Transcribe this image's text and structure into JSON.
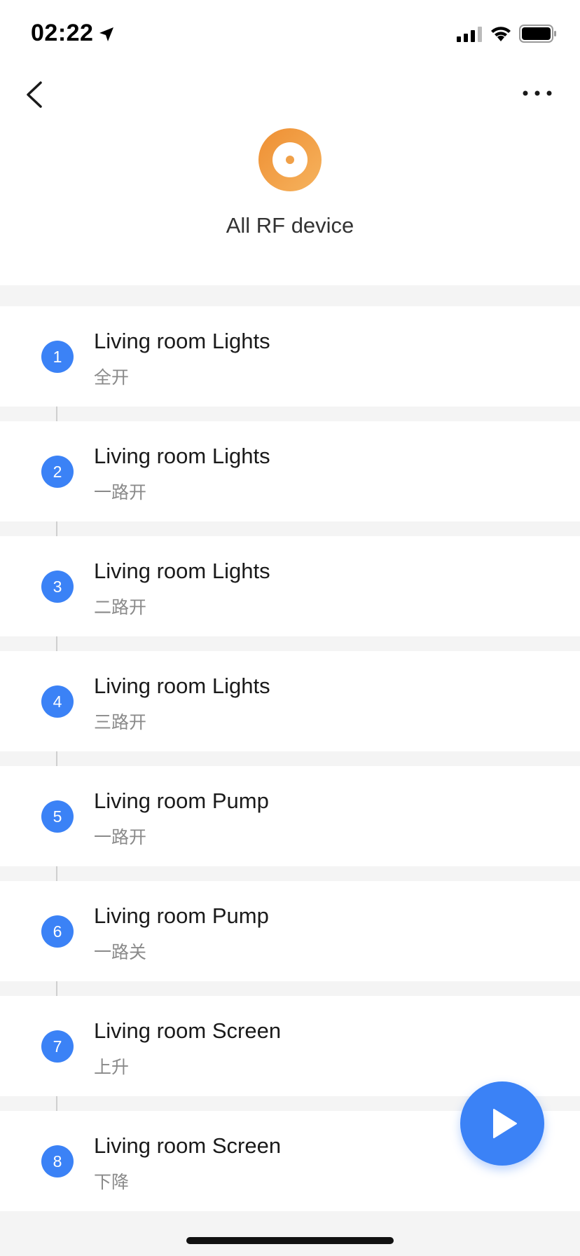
{
  "status_bar": {
    "time": "02:22",
    "icons": [
      "location-arrow-icon",
      "cellular-signal-icon",
      "wifi-icon",
      "battery-icon"
    ]
  },
  "header": {
    "back_icon": "chevron-left-icon",
    "more_icon": "more-dots-icon",
    "device_icon": "rf-device-icon",
    "title": "All RF device"
  },
  "items": [
    {
      "index": "1",
      "name": "Living room Lights",
      "action": "全开"
    },
    {
      "index": "2",
      "name": "Living room Lights",
      "action": "一路开"
    },
    {
      "index": "3",
      "name": "Living room Lights",
      "action": "二路开"
    },
    {
      "index": "4",
      "name": "Living room Lights",
      "action": "三路开"
    },
    {
      "index": "5",
      "name": "Living room Pump",
      "action": "一路开"
    },
    {
      "index": "6",
      "name": "Living room Pump",
      "action": "一路关"
    },
    {
      "index": "7",
      "name": "Living room Screen",
      "action": "上升"
    },
    {
      "index": "8",
      "name": "Living room Screen",
      "action": "下降"
    }
  ],
  "fab": {
    "icon": "play-icon"
  },
  "colors": {
    "accent": "#3b82f6",
    "device_icon_orange": "#f0a048",
    "background": "#f4f4f4"
  }
}
